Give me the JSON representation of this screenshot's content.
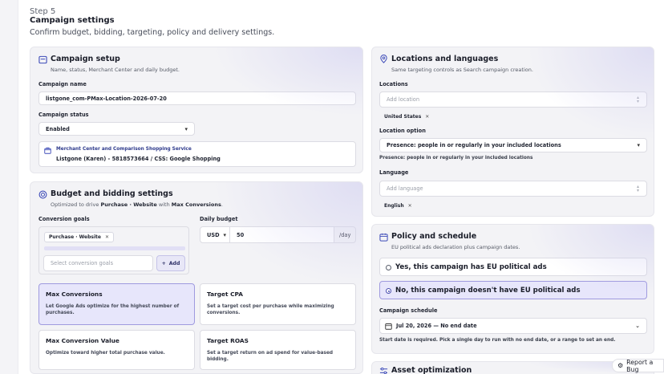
{
  "header": {
    "step": "Step 5",
    "title": "Campaign settings",
    "subtitle": "Confirm budget, bidding, targeting, policy and delivery settings."
  },
  "setup": {
    "title": "Campaign setup",
    "desc": "Name, status, Merchant Center and daily budget.",
    "name_label": "Campaign name",
    "name_value": "listgone_com-PMax-Location-2026-07-20",
    "status_label": "Campaign status",
    "status_value": "Enabled",
    "merchant_title": "Merchant Center and Comparison Shopping Service",
    "merchant_value": "Listgone (Karen) - 5818573664 / CSS: Google Shopping"
  },
  "budget": {
    "title": "Budget and bidding settings",
    "desc_prefix": "Optimized to drive",
    "desc_goal": "Purchase · Website",
    "desc_with": "with",
    "desc_strategy": "Max Conversions",
    "desc_end": ".",
    "goals_label": "Conversion goals",
    "goal_chip": "Purchase · Website",
    "goal_placeholder": "Select conversion goals",
    "add_label": "Add",
    "daily_label": "Daily budget",
    "currency": "USD",
    "amount": "50",
    "per_day": "/day",
    "strategies": [
      {
        "title": "Max Conversions",
        "desc": "Let Google Ads optimize for the highest number of purchases."
      },
      {
        "title": "Target CPA",
        "desc": "Set a target cost per purchase while maximizing conversions."
      },
      {
        "title": "Max Conversion Value",
        "desc": "Optimize toward higher total purchase value."
      },
      {
        "title": "Target ROAS",
        "desc": "Set a target return on ad spend for value-based bidding."
      }
    ]
  },
  "locations": {
    "title": "Locations and languages",
    "desc": "Same targeting controls as Search campaign creation.",
    "locations_label": "Locations",
    "location_placeholder": "Add location",
    "location_chip": "United States",
    "option_label": "Location option",
    "option_value": "Presence: people in or regularly in your included locations",
    "option_hint": "Presence: people in or regularly in your included locations",
    "language_label": "Language",
    "language_placeholder": "Add language",
    "language_chip": "English"
  },
  "policy": {
    "title": "Policy and schedule",
    "desc": "EU political ads declaration plus campaign dates.",
    "option_yes": "Yes, this campaign has EU political ads",
    "option_no": "No, this campaign doesn't have EU political ads",
    "schedule_label": "Campaign schedule",
    "schedule_value": "Jul 20, 2026 — No end date",
    "schedule_hint": "Start date is required. Pick a single day to run with no end date, or a range to set an end."
  },
  "asset": {
    "title": "Asset optimization"
  },
  "report": {
    "label": "Report a Bug"
  },
  "icons": {
    "setup": "campaign-setup-icon",
    "budget": "budget-icon",
    "locations": "location-pin-icon",
    "policy": "calendar-icon",
    "asset": "sliders-icon"
  },
  "colors": {
    "accent": "#3d4bb8",
    "selected_bg": "#e7e6fb",
    "card_bg": "#f3f3f6"
  }
}
